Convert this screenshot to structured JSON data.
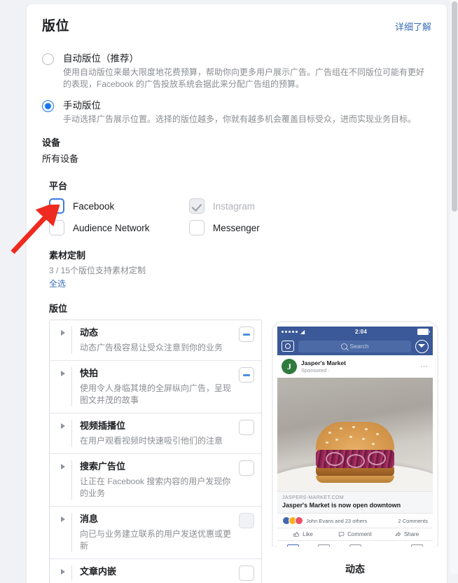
{
  "header": {
    "title": "版位",
    "learn_more": "详细了解"
  },
  "placement_mode": {
    "options": [
      {
        "label": "自动版位（推荐）",
        "description": "使用自动版位来最大限度地花费预算，帮助你向更多用户展示广告。广告组在不同版位可能有更好的表现，Facebook 的广告投放系统会据此来分配广告组的预算。",
        "selected": false
      },
      {
        "label": "手动版位",
        "description": "手动选择广告展示位置。选择的版位越多，你就有越多机会覆盖目标受众，进而实现业务目标。",
        "selected": true
      }
    ]
  },
  "device": {
    "title": "设备",
    "value": "所有设备"
  },
  "platform": {
    "title": "平台",
    "items": [
      {
        "label": "Facebook",
        "state": "unchecked-focused"
      },
      {
        "label": "Instagram",
        "state": "checked-disabled"
      },
      {
        "label": "Audience Network",
        "state": "unchecked"
      },
      {
        "label": "Messenger",
        "state": "unchecked"
      }
    ]
  },
  "creative_customization": {
    "title": "素材定制",
    "count_text": "3 / 15个版位支持素材定制",
    "select_all": "全选"
  },
  "placements": {
    "title": "版位",
    "items": [
      {
        "name": "动态",
        "desc": "动态广告极容易让受众注意到你的业务",
        "checkbox": "indeterminate"
      },
      {
        "name": "快拍",
        "desc": "使用令人身临其境的全屏纵向广告，呈现图文并茂的故事",
        "checkbox": "indeterminate"
      },
      {
        "name": "视频插播位",
        "desc": "在用户观看视频时快速吸引他们的注意",
        "checkbox": "unchecked"
      },
      {
        "name": "搜索广告位",
        "desc": "让正在 Facebook 搜索内容的用户发现你的业务",
        "checkbox": "unchecked"
      },
      {
        "name": "消息",
        "desc": "向已与业务建立联系的用户发送优惠或更新",
        "checkbox": "disabled"
      },
      {
        "name": "文章内嵌",
        "desc": "",
        "checkbox": "unchecked"
      }
    ]
  },
  "preview": {
    "label": "动态",
    "phone": {
      "status_time": "2:04",
      "search_placeholder": "Search",
      "page_name": "Jasper's Market",
      "sponsored": "Sponsored ·",
      "avatar_letter": "J",
      "link_domain": "JASPERS-MARKET.COM",
      "link_title": "Jasper's Market is now open downtown",
      "reactions_text": "John Evans and 23 others",
      "comments_text": "2 Comments",
      "actions": [
        "Like",
        "Comment",
        "Share"
      ]
    }
  },
  "colors": {
    "accent_blue": "#1877f2",
    "link_blue": "#3a6fb7",
    "fb_navy": "#3b5998",
    "arrow_red": "#ee2b20",
    "muted_text": "#8a8d91"
  }
}
